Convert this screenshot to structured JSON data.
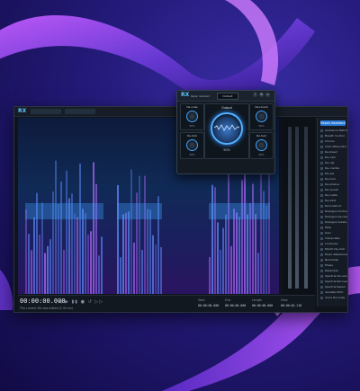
{
  "app": {
    "logo": "RX",
    "timecode": "00:00:00.000",
    "status_text": "The current file was edited (1.55 ms)",
    "transport_icons": "|◀ ▶ ▮▮ ● ↺ ▷▷",
    "selection": {
      "start_label": "Start",
      "end_label": "End",
      "length_label": "Length",
      "view_label": "View",
      "start_value": "00:00:00.000",
      "end_value": "00:00:00.000",
      "length_value": "00:00:00.000",
      "view_value": "00:00:04.110"
    },
    "sidebar": {
      "top_button": "Repair Assistant",
      "modules": [
        "Ambience Match",
        "Breath Control",
        "Chorus",
        "Click Attenuator",
        "De-bleed",
        "De-click",
        "De-clip",
        "De-crackle",
        "De-ess",
        "De-hum",
        "De-plosive",
        "De-reverb",
        "De-rustle",
        "De-wind",
        "Deconstruct",
        "Dialogue Contour",
        "Dialogue De-reverb",
        "Dialogue Isolate",
        "Fade",
        "Gain",
        "Interpolate",
        "Loudness",
        "Mouth De-click",
        "Music Rebalance",
        "Normalize",
        "Phase",
        "Resample",
        "Spectral De-noise",
        "Spectral Recovery",
        "Spectral Repair",
        "Variable Pitch",
        "Voice De-noise"
      ]
    }
  },
  "plugin": {
    "logo": "RX",
    "subtitle": "Repair Assistant",
    "preset": "Default",
    "icons": [
      "?",
      "⚙",
      "×"
    ],
    "cells": [
      {
        "label": "De-noise",
        "value": "50%"
      },
      {
        "label": "De-reverb",
        "value": "50%"
      },
      {
        "label": "De-click",
        "value": "50%"
      },
      {
        "label": "De-hum",
        "value": "50%"
      }
    ],
    "center": {
      "label": "Output",
      "value": "50%"
    }
  },
  "colors": {
    "accent": "#3fa3ff",
    "background": "#241a7a",
    "ribbon": "#8a4bff"
  }
}
